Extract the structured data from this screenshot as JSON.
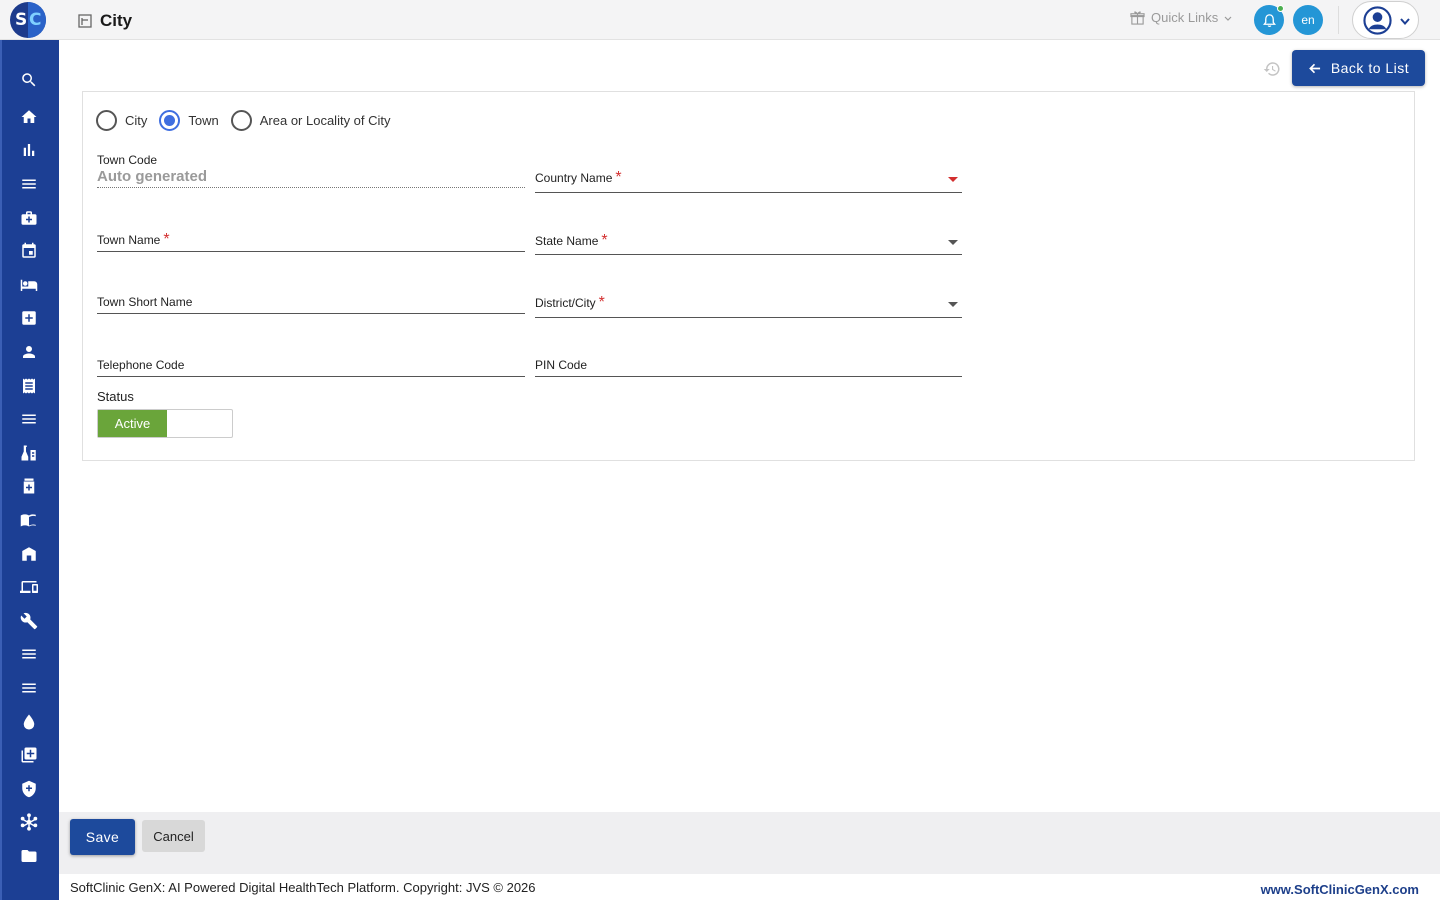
{
  "header": {
    "title": "City",
    "quick_links_label": "Quick Links",
    "lang_code": "en"
  },
  "sidebar": {
    "items": [
      {
        "icon": "search-icon"
      },
      {
        "icon": "home-icon"
      },
      {
        "icon": "bar-chart-icon"
      },
      {
        "icon": "menu-icon"
      },
      {
        "icon": "medical-bag-icon"
      },
      {
        "icon": "calendar-icon"
      },
      {
        "icon": "bed-icon"
      },
      {
        "icon": "plus-box-icon"
      },
      {
        "icon": "person-icon"
      },
      {
        "icon": "receipt-icon"
      },
      {
        "icon": "menu-icon"
      },
      {
        "icon": "lab-icon"
      },
      {
        "icon": "pharmacy-icon"
      },
      {
        "icon": "book-icon"
      },
      {
        "icon": "store-icon"
      },
      {
        "icon": "devices-icon"
      },
      {
        "icon": "wrench-icon"
      },
      {
        "icon": "menu-icon"
      },
      {
        "icon": "menu-icon"
      },
      {
        "icon": "blood-drop-icon"
      },
      {
        "icon": "add-note-icon"
      },
      {
        "icon": "shield-plus-icon"
      },
      {
        "icon": "hub-icon"
      },
      {
        "icon": "folder-icon"
      }
    ]
  },
  "toolbar": {
    "back_label": "Back to List"
  },
  "form": {
    "type_options": [
      {
        "label": "City",
        "checked": false
      },
      {
        "label": "Town",
        "checked": true
      },
      {
        "label": "Area or Locality of City",
        "checked": false
      }
    ],
    "town_code": {
      "label": "Town Code",
      "value": "Auto generated"
    },
    "country_name": {
      "label": "Country Name",
      "required": "*"
    },
    "town_name": {
      "label": "Town Name",
      "required": "*"
    },
    "state_name": {
      "label": "State Name",
      "required": "*"
    },
    "town_short_name": {
      "label": "Town Short Name"
    },
    "district_city": {
      "label": "District/City",
      "required": "*"
    },
    "telephone_code": {
      "label": "Telephone Code"
    },
    "pin_code": {
      "label": "PIN Code"
    },
    "status": {
      "label": "Status",
      "value": "Active"
    }
  },
  "actions": {
    "save_label": "Save",
    "cancel_label": "Cancel"
  },
  "footer": {
    "copyright": "SoftClinic GenX: AI Powered Digital HealthTech Platform. Copyright: JVS © 2026",
    "website": "www.SoftClinicGenX.com"
  },
  "colors": {
    "primary": "#1d4a9c",
    "sidebar": "#1c3f94",
    "accent": "#2496d6",
    "status_active": "#6aa53a",
    "required": "#d32f2f"
  }
}
